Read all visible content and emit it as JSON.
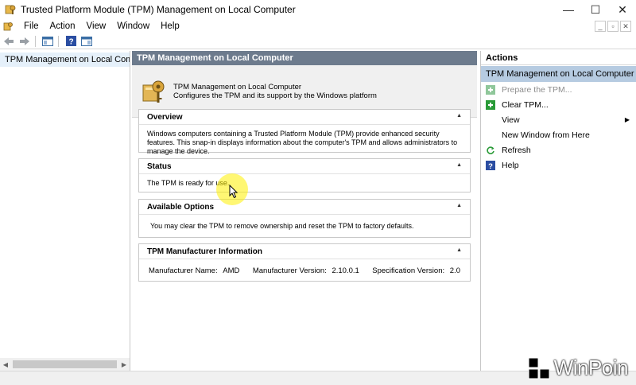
{
  "window": {
    "title": "Trusted Platform Module (TPM) Management on Local Computer",
    "minimize": "—",
    "maximize": "☐",
    "close": "✕"
  },
  "menu": {
    "items": [
      "File",
      "Action",
      "View",
      "Window",
      "Help"
    ],
    "mdi_minimize": "_",
    "mdi_restore": "▫",
    "mdi_close": "✕"
  },
  "tree": {
    "root_label": "TPM Management on Local Comp"
  },
  "center": {
    "header": "TPM Management on Local Computer",
    "intro_title": "TPM Management on Local Computer",
    "intro_desc": "Configures the TPM and its support by the Windows platform",
    "overview": {
      "title": "Overview",
      "text": "Windows computers containing a Trusted Platform Module (TPM) provide enhanced security features. This snap-in displays information about the computer's TPM and allows administrators to manage the device."
    },
    "status": {
      "title": "Status",
      "text": "The TPM is ready for use."
    },
    "options": {
      "title": "Available Options",
      "text": "You may clear the TPM to remove ownership and reset the TPM to factory defaults."
    },
    "manufacturer": {
      "title": "TPM Manufacturer Information",
      "name_label": "Manufacturer Name:",
      "name_value": "AMD",
      "version_label": "Manufacturer Version:",
      "version_value": "2.10.0.1",
      "spec_label": "Specification Version:",
      "spec_value": "2.0"
    },
    "collapse_glyph": "▲"
  },
  "actions": {
    "header": "Actions",
    "group": "TPM Management on Local Computer",
    "items": [
      {
        "label": "Prepare the TPM...",
        "enabled": false
      },
      {
        "label": "Clear TPM...",
        "enabled": true
      },
      {
        "label": "View",
        "enabled": true
      },
      {
        "label": "New Window from Here",
        "enabled": true
      },
      {
        "label": "Refresh",
        "enabled": true
      },
      {
        "label": "Help",
        "enabled": true
      }
    ],
    "submenu_arrow": "▶"
  },
  "watermark": {
    "text": "WinPoin"
  },
  "colors": {
    "center_header_bg": "#6d7b8d",
    "actions_group_bg": "#b6cbe1",
    "tree_selected_bg": "#e5f0fa",
    "green_action": "#2a9b38",
    "help_blue": "#2b4ea2"
  }
}
